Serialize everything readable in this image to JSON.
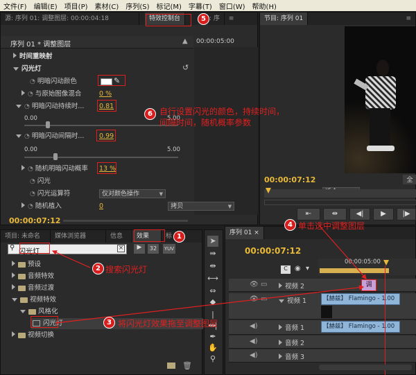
{
  "menu": [
    "文件(F)",
    "编辑(E)",
    "项目(P)",
    "素材(C)",
    "序列(S)",
    "标记(M)",
    "字幕(T)",
    "窗口(W)",
    "帮助(H)"
  ],
  "ec": {
    "tab_source": "源: 序列 01: 调整图层: 00:00:04:18",
    "tab_fx": "特效控制台",
    "tab_audio": "台: 序",
    "timecode_top": "00:00:05:00",
    "clip_name": "序列 01 * 调整图层",
    "time_remap": "时间重映射",
    "fx_name": "闪光灯",
    "fx_prefix": "fx",
    "props": [
      {
        "label": "明暗闪动颜色"
      },
      {
        "label": "与原始图像混合",
        "value": "0 %"
      },
      {
        "label": "明暗闪动持续时...",
        "value": "0.81"
      },
      {
        "label": "明暗闪动间隔时...",
        "value": "0.99"
      },
      {
        "label": "随机明暗闪动概率",
        "value": "13 %"
      },
      {
        "label": "闪光",
        "value": "仅对颜色操作"
      },
      {
        "label": "闪光运算符",
        "value": "拷贝"
      },
      {
        "label": "随机植入",
        "value": "0"
      }
    ],
    "slider1": {
      "min": "0.00",
      "max": "5.00"
    },
    "slider2": {
      "min": "0.00",
      "max": "5.00"
    },
    "timecode_bottom": "00:00:07:12"
  },
  "program": {
    "tab": "节目: 序列 01",
    "timecode": "00:00:07:12",
    "fit": "适合",
    "full": "全"
  },
  "project": {
    "tabs": [
      "项目: 未命名",
      "媒体浏览器",
      "信息",
      "效果",
      "标"
    ],
    "search_value": "闪光灯",
    "tree": [
      {
        "label": "预设"
      },
      {
        "label": "音频特效"
      },
      {
        "label": "音频过渡"
      },
      {
        "label": "视频特效"
      },
      {
        "label": "风格化"
      },
      {
        "label": "闪光灯"
      },
      {
        "label": "视频切换"
      }
    ]
  },
  "timeline": {
    "tab": "序列 01",
    "timecode": "00:00:07:12",
    "ruler_time": "00:00:05:00",
    "adjust_clip": "调",
    "tracks": [
      {
        "label": "视频 2"
      },
      {
        "label": "视频 1"
      },
      {
        "label": "音频 1"
      },
      {
        "label": "音频 2"
      },
      {
        "label": "音频 3"
      }
    ],
    "clip_video": "【赫兹】 Flamingo - 1.00",
    "clip_audio": "【赫兹】 Flamingo - 1.00",
    "side_v": "V",
    "side_a": "A1"
  },
  "annotations": {
    "n1": "1",
    "n2": "2",
    "n3": "3",
    "n4": "4",
    "n5": "5",
    "n6": "6",
    "a2": "搜索闪光灯",
    "a3": "将闪光灯效果拖至调整图层",
    "a4": "单击选中调整图层",
    "a6_line1": "自行设置闪光的颜色，持续时间，",
    "a6_line2": "间隔时间，随机概率参数"
  },
  "colors": {
    "accent": "#e8b838",
    "annotation": "#e02020",
    "clip": "#8fb6d8"
  }
}
